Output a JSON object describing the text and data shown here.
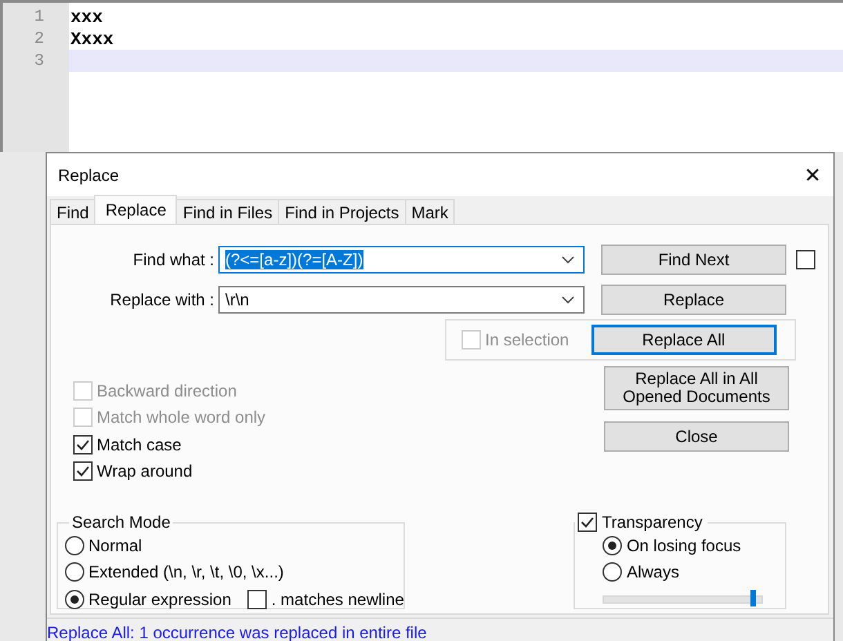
{
  "editor": {
    "lines": [
      {
        "number": "1",
        "text": "xxx",
        "current": false
      },
      {
        "number": "2",
        "text": "Xxxx",
        "current": false
      },
      {
        "number": "3",
        "current": true
      }
    ]
  },
  "dialog": {
    "title": "Replace",
    "close": "✕",
    "tabs": [
      {
        "label": "Find",
        "selected": false
      },
      {
        "label": "Replace",
        "selected": true
      },
      {
        "label": "Find in Files",
        "selected": false
      },
      {
        "label": "Find in Projects",
        "selected": false
      },
      {
        "label": "Mark",
        "selected": false
      }
    ],
    "fields": [
      {
        "label": "Find what :",
        "value": "(?<=[a-z])(?=[A-Z])",
        "highlighted": true,
        "focused": true
      },
      {
        "label": "Replace with :",
        "value": "\\r\\n",
        "highlighted": false,
        "focused": false
      }
    ],
    "buttons": [
      {
        "label": "Find Next",
        "focused": false
      },
      {
        "label": "Replace",
        "focused": false
      },
      {
        "label": "Replace All",
        "focused": true
      },
      {
        "label": "Replace All in All Opened Documents",
        "focused": false
      },
      {
        "label": "Close",
        "focused": false
      }
    ],
    "side_checkbox": {
      "checked": false
    },
    "in_selection": {
      "label": "In selection",
      "checked": false,
      "disabled": true
    },
    "options": [
      {
        "label": "Backward direction",
        "checked": false,
        "disabled": true
      },
      {
        "label": "Match whole word only",
        "checked": false,
        "disabled": true
      },
      {
        "label": "Match case",
        "checked": true,
        "disabled": false
      },
      {
        "label": "Wrap around",
        "checked": true,
        "disabled": false
      }
    ],
    "search_mode": {
      "title": "Search Mode",
      "modes": [
        {
          "label": "Normal",
          "selected": false
        },
        {
          "label": "Extended (\\n, \\r, \\t, \\0, \\x...)",
          "selected": false
        },
        {
          "label": "Regular expression",
          "selected": true
        }
      ],
      "dot_newline": {
        "label": ". matches newline",
        "checked": false
      }
    },
    "transparency": {
      "label": "Transparency",
      "checked": true,
      "modes": [
        {
          "label": "On losing focus",
          "selected": true
        },
        {
          "label": "Always",
          "selected": false
        }
      ],
      "level": 0.97
    },
    "status": "Replace All: 1 occurrence was replaced in entire file"
  }
}
